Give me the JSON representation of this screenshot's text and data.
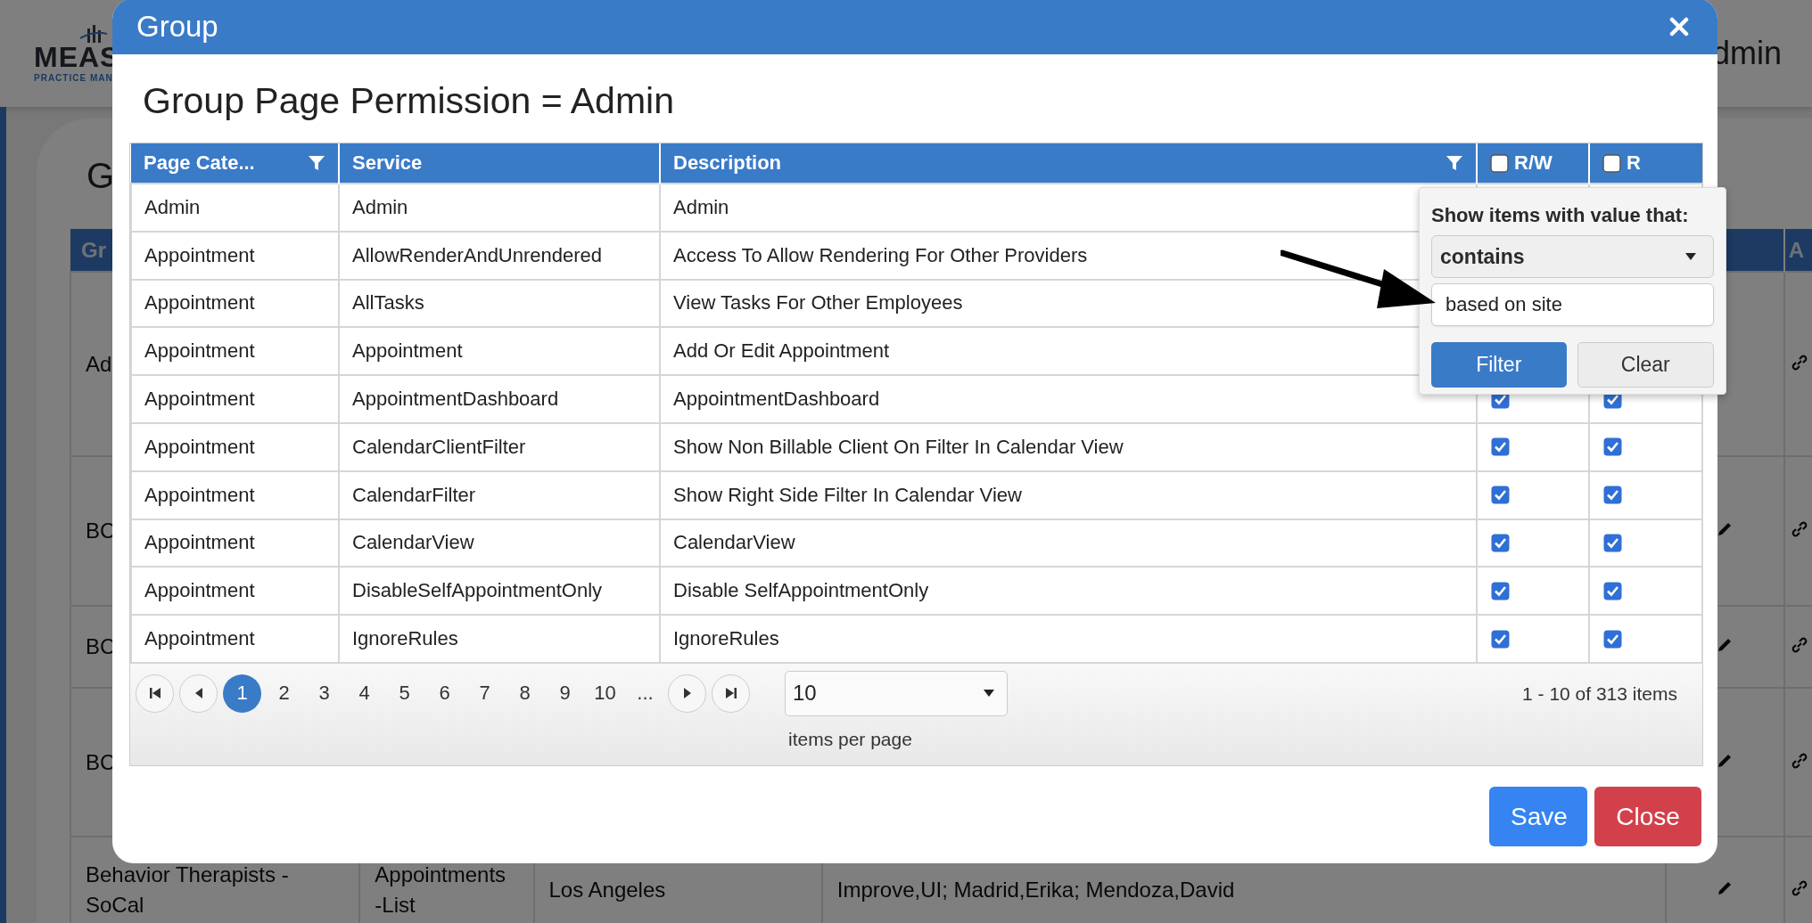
{
  "background_page": {
    "logo": {
      "name": "MEAS",
      "tagline": "PRACTICE MAN"
    },
    "user": "dmin",
    "title": "G",
    "table": {
      "column_1": "Gr",
      "column_6": "A",
      "rows": [
        {
          "column_1": "Ad",
          "edit_icon": false,
          "link_icon": true
        },
        {
          "column_1": "BC",
          "edit_icon": true,
          "link_icon": true
        },
        {
          "column_1": "BC",
          "edit_icon": true,
          "link_icon": true
        },
        {
          "column_1": "BC",
          "edit_icon": true,
          "link_icon": true
        },
        {
          "column_1": "Behavior Therapists - SoCal",
          "column_2": "Appointments -List",
          "column_3": "Los Angeles",
          "column_4": "Improve,UI; Madrid,Erika; Mendoza,David",
          "edit_icon": true,
          "link_icon": true
        }
      ]
    }
  },
  "dialog": {
    "title": "Group",
    "heading": "Group Page Permission = Admin",
    "grid": {
      "columns": [
        {
          "label": "Page Cate...",
          "kind": "text",
          "filter": true
        },
        {
          "label": "Service",
          "kind": "text",
          "filter": false
        },
        {
          "label": "Description",
          "kind": "text",
          "filter": true
        },
        {
          "label": "R/W",
          "kind": "checkbox",
          "checked": false
        },
        {
          "label": "R",
          "kind": "checkbox",
          "checked": false
        }
      ],
      "rows": [
        {
          "category": "Admin",
          "service": "Admin",
          "description": "Admin"
        },
        {
          "category": "Appointment",
          "service": "AllowRenderAndUnrendered",
          "description": "Access To Allow Rendering For Other Providers"
        },
        {
          "category": "Appointment",
          "service": "AllTasks",
          "description": "View Tasks For Other Employees"
        },
        {
          "category": "Appointment",
          "service": "Appointment",
          "description": "Add Or Edit Appointment"
        },
        {
          "category": "Appointment",
          "service": "AppointmentDashboard",
          "description": "AppointmentDashboard",
          "rw": true,
          "r": true
        },
        {
          "category": "Appointment",
          "service": "CalendarClientFilter",
          "description": "Show Non Billable Client On Filter In Calendar View",
          "rw": true,
          "r": true
        },
        {
          "category": "Appointment",
          "service": "CalendarFilter",
          "description": "Show Right Side Filter In Calendar View",
          "rw": true,
          "r": true
        },
        {
          "category": "Appointment",
          "service": "CalendarView",
          "description": "CalendarView",
          "rw": true,
          "r": true
        },
        {
          "category": "Appointment",
          "service": "DisableSelfAppointmentOnly",
          "description": "Disable SelfAppointmentOnly",
          "rw": true,
          "r": true
        },
        {
          "category": "Appointment",
          "service": "IgnoreRules",
          "description": "IgnoreRules",
          "rw": true,
          "r": true
        }
      ]
    },
    "pager": {
      "pages": [
        {
          "label": "1",
          "selected": true
        },
        {
          "label": "2",
          "selected": false
        },
        {
          "label": "3",
          "selected": false
        },
        {
          "label": "4",
          "selected": false
        },
        {
          "label": "5",
          "selected": false
        },
        {
          "label": "6",
          "selected": false
        },
        {
          "label": "7",
          "selected": false
        },
        {
          "label": "8",
          "selected": false
        },
        {
          "label": "9",
          "selected": false
        },
        {
          "label": "10",
          "selected": false
        },
        {
          "label": "...",
          "selected": false
        }
      ],
      "page_size": "10",
      "page_size_label": "items per page",
      "summary": "1 - 10 of 313 items"
    },
    "buttons": [
      {
        "label": "Save",
        "kind": "primary"
      },
      {
        "label": "Close",
        "kind": "danger"
      }
    ]
  },
  "filter_menu": {
    "label": "Show items with value that:",
    "operator": "contains",
    "value": "based on site",
    "buttons": [
      {
        "label": "Filter",
        "kind": "primary"
      },
      {
        "label": "Clear",
        "kind": "secondary"
      }
    ]
  },
  "annotation": {
    "kind": "arrow"
  }
}
